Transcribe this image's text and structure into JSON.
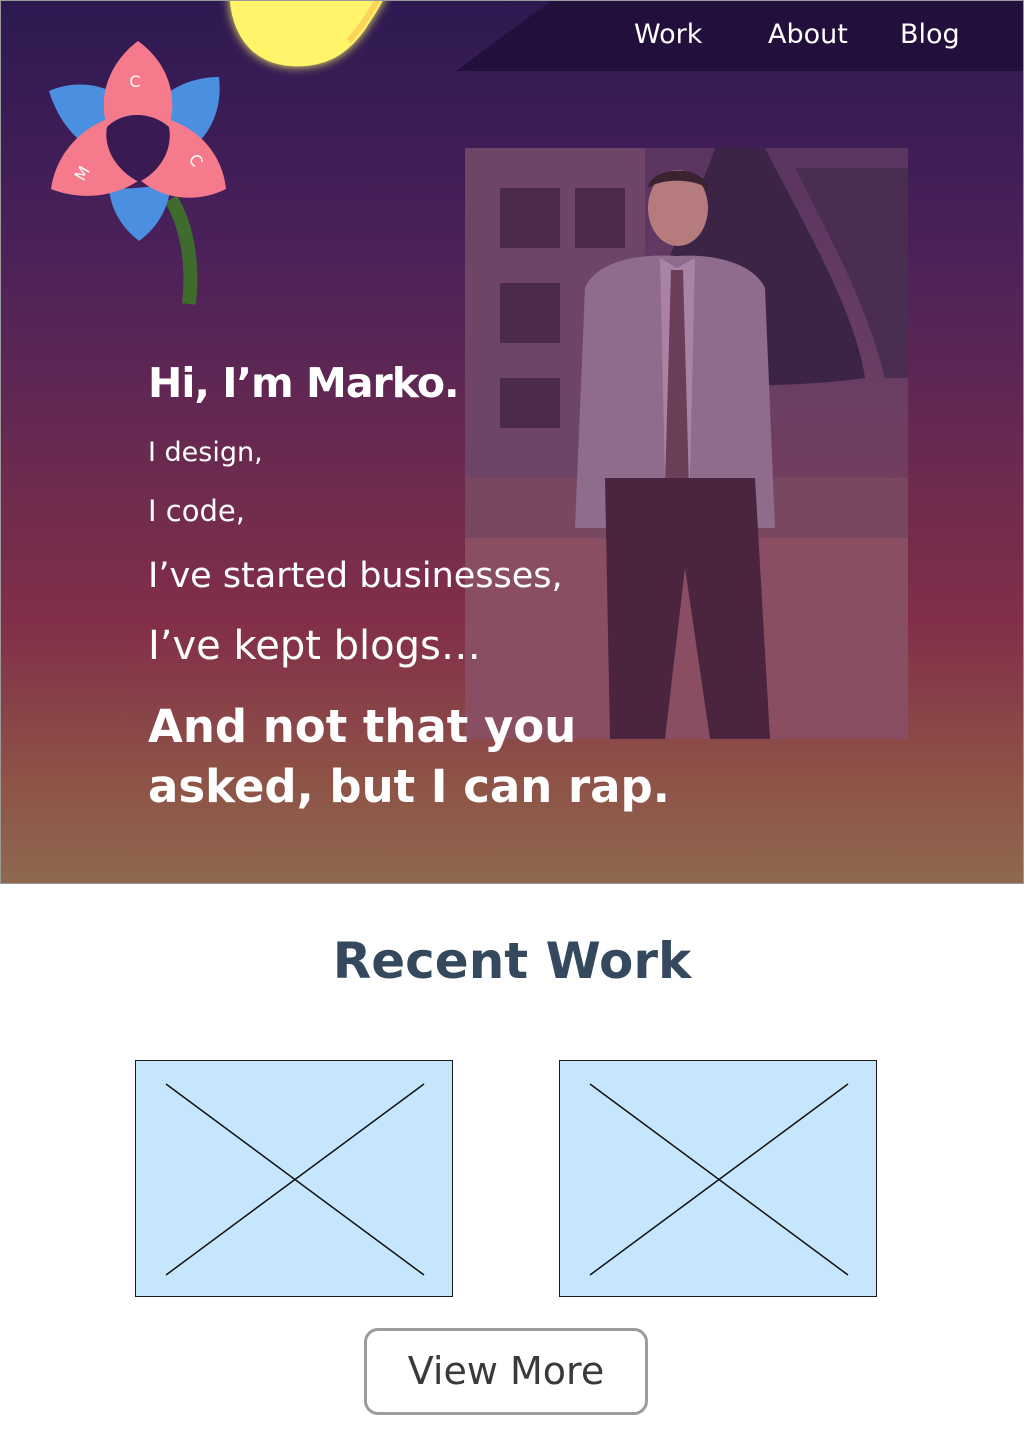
{
  "nav": {
    "items": [
      {
        "label": "Work"
      },
      {
        "label": "About"
      },
      {
        "label": "Blog"
      }
    ]
  },
  "logo": {
    "letters": [
      "C",
      "C",
      "M"
    ],
    "colors": {
      "petal_pink": "#f47a8c",
      "petal_blue": "#4a8fe0",
      "stem": "#3f6b2c"
    }
  },
  "hero": {
    "greeting": "Hi, I’m Marko.",
    "lines": [
      "I design,",
      "I code,",
      "I’ve started businesses,",
      "I’ve kept blogs…",
      "And not that you asked, but I can rap."
    ]
  },
  "recent_work": {
    "title": "Recent Work",
    "cards": [
      {
        "icon": "image-placeholder-icon"
      },
      {
        "icon": "image-placeholder-icon"
      }
    ],
    "view_more_label": "View More"
  },
  "colors": {
    "heading": "#34495e",
    "card_bg": "#c5e6fd",
    "sun": "#fff46a",
    "nav_bg": "#220f3b"
  }
}
